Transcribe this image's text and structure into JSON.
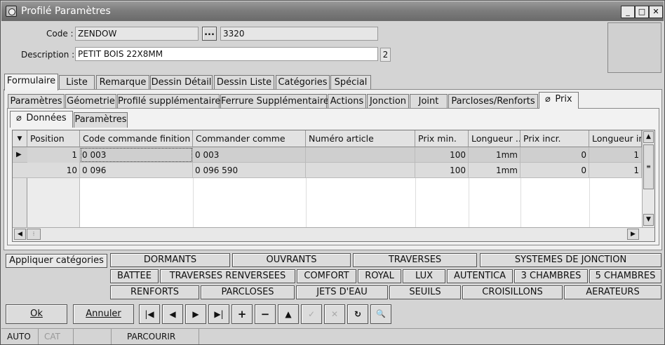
{
  "window": {
    "title": "Profilé Paramètres",
    "min": "_",
    "max": "□",
    "close": "✕"
  },
  "form": {
    "code_label": "Code :",
    "code_value": "ZENDOW",
    "browse_label": "...",
    "code_num": "3320",
    "desc_label": "Description :",
    "desc_value": "PETIT BOIS 22X8MM",
    "desc_count": "2"
  },
  "main_tabs": [
    "Formulaire",
    "Liste",
    "Remarque",
    "Dessin Détail",
    "Dessin Liste",
    "Catégories",
    "Spécial"
  ],
  "sub_tabs": [
    "Paramètres",
    "Géometrie",
    "Profilé supplémentaire",
    "Ferrure Supplémentaire",
    "Actions",
    "Jonction",
    "Joint",
    "Parcloses/Renforts",
    "Prix"
  ],
  "inner_tabs": [
    "Données",
    "Paramètres"
  ],
  "grid": {
    "columns": [
      "Position",
      "Code commande finition",
      "Commander comme",
      "Numéro article",
      "Prix min.",
      "Longueur ...",
      "Prix incr.",
      "Longueur in"
    ],
    "rows": [
      [
        "1",
        "0 003",
        "0 003",
        "",
        "100",
        "1mm",
        "0",
        "1"
      ],
      [
        "10",
        "0 096",
        "0 096 590",
        "",
        "100",
        "1mm",
        "0",
        "1"
      ]
    ]
  },
  "categories": {
    "apply_label": "Appliquer catégories",
    "row1": [
      "DORMANTS",
      "OUVRANTS",
      "TRAVERSES",
      "SYSTEMES DE JONCTION"
    ],
    "row2": [
      "BATTEE",
      "TRAVERSES RENVERSEES",
      "COMFORT",
      "ROYAL",
      "LUX",
      "AUTENTICA",
      "3 CHAMBRES",
      "5 CHAMBRES"
    ],
    "row3": [
      "RENFORTS",
      "PARCLOSES",
      "JETS D'EAU",
      "SEUILS",
      "CROISILLONS",
      "AERATEURS"
    ]
  },
  "buttons": {
    "ok": "Ok",
    "cancel": "Annuler"
  },
  "status": {
    "mode": "AUTO",
    "cat": "CAT",
    "action": "PARCOURIR"
  }
}
